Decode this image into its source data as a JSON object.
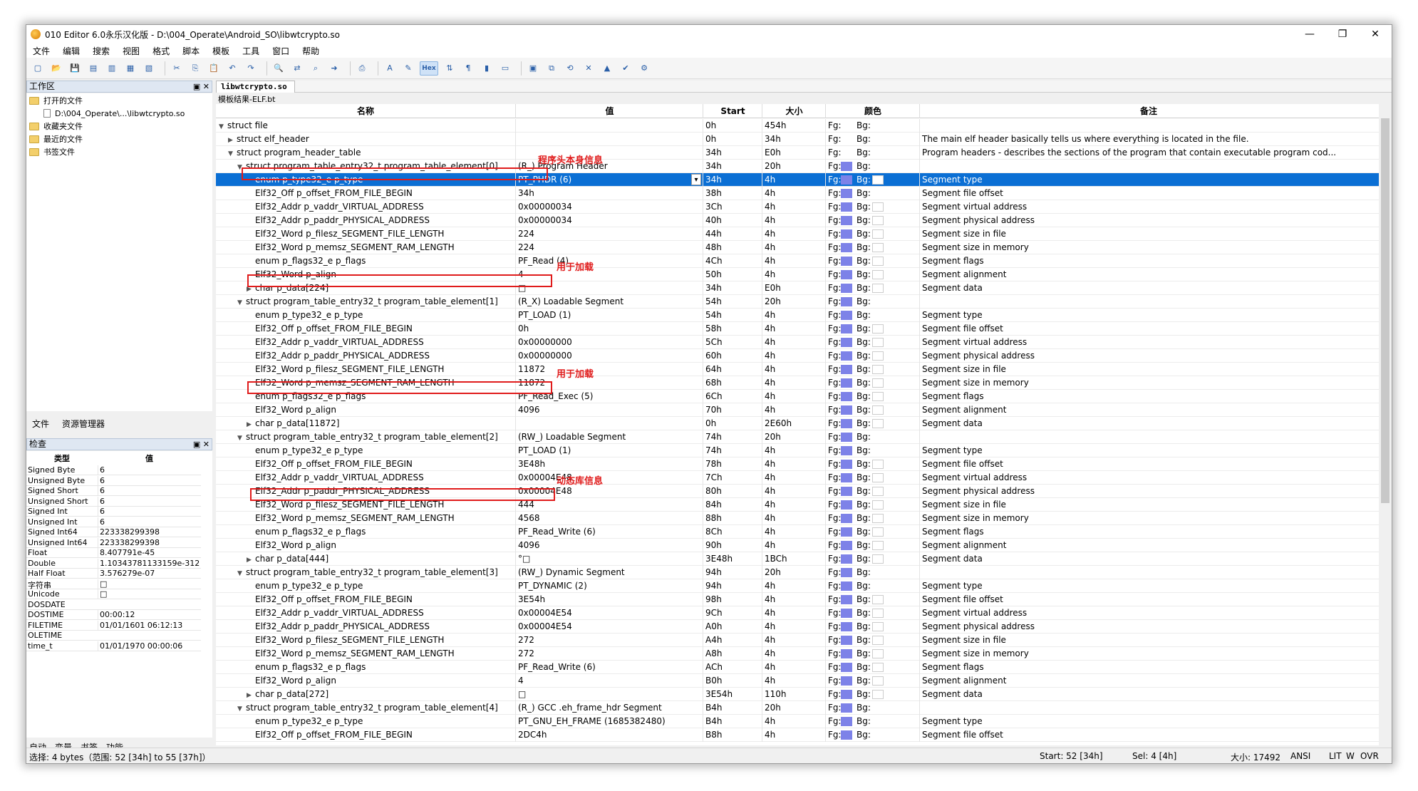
{
  "window": {
    "title": "010 Editor 6.0永乐汉化版 - D:\\004_Operate\\Android_SO\\libwtcrypto.so",
    "minimize": "—",
    "restore": "❐",
    "close": "✕"
  },
  "menu": [
    "文件",
    "编辑",
    "搜索",
    "视图",
    "格式",
    "脚本",
    "模板",
    "工具",
    "窗口",
    "帮助"
  ],
  "toolbar": {
    "hex_label": "Hex"
  },
  "workspace": {
    "title": "工作区",
    "items": [
      {
        "label": "打开的文件"
      },
      {
        "label": "D:\\004_Operate\\...\\libwtcrypto.so"
      },
      {
        "label": "收藏夹文件"
      },
      {
        "label": "最近的文件"
      },
      {
        "label": "书签文件"
      }
    ]
  },
  "left_tabs": [
    "文件",
    "资源管理器"
  ],
  "inspector": {
    "title": "检查",
    "headers": [
      "类型",
      "值"
    ],
    "rows": [
      {
        "k": "Signed Byte",
        "v": "6"
      },
      {
        "k": "Unsigned Byte",
        "v": "6"
      },
      {
        "k": "Signed Short",
        "v": "6"
      },
      {
        "k": "Unsigned Short",
        "v": "6"
      },
      {
        "k": "Signed Int",
        "v": "6"
      },
      {
        "k": "Unsigned Int",
        "v": "6"
      },
      {
        "k": "Signed Int64",
        "v": "223338299398"
      },
      {
        "k": "Unsigned Int64",
        "v": "223338299398"
      },
      {
        "k": "Float",
        "v": "8.407791e-45"
      },
      {
        "k": "Double",
        "v": "1.10343781133159e-312"
      },
      {
        "k": "Half Float",
        "v": "3.576279e-07"
      },
      {
        "k": "字符串",
        "v": "□"
      },
      {
        "k": "Unicode",
        "v": "□"
      },
      {
        "k": "DOSDATE",
        "v": ""
      },
      {
        "k": "DOSTIME",
        "v": "00:00:12"
      },
      {
        "k": "FILETIME",
        "v": "01/01/1601 06:12:13"
      },
      {
        "k": "OLETIME",
        "v": ""
      },
      {
        "k": "time_t",
        "v": "01/01/1970 00:00:06"
      }
    ]
  },
  "bottom_tabs": [
    "自动",
    "变量",
    "书签",
    "功能"
  ],
  "file_tab": "libwtcrypto.so",
  "template_result": "模板结果-ELF.bt",
  "grid": {
    "headers": [
      "名称",
      "值",
      "Start",
      "大小",
      "颜色",
      "备注"
    ],
    "fg_label": "Fg:",
    "bg_label": "Bg:",
    "rows": [
      {
        "d": 0,
        "a": "v",
        "n": "struct file",
        "v": "",
        "s": "0h",
        "z": "454h",
        "fs": false,
        "bs": false,
        "m": ""
      },
      {
        "d": 1,
        "a": ">",
        "n": "struct elf_header",
        "v": "",
        "s": "0h",
        "z": "34h",
        "fs": false,
        "bs": false,
        "m": "The main elf header basically tells us where everything is located in the file."
      },
      {
        "d": 1,
        "a": "v",
        "n": "struct program_header_table",
        "v": "",
        "s": "34h",
        "z": "E0h",
        "fs": false,
        "bs": false,
        "m": "Program headers - describes the sections of the program that contain executable program cod..."
      },
      {
        "d": 2,
        "a": "v",
        "n": "struct program_table_entry32_t program_table_element[0]",
        "v": "(R_) Program Header",
        "s": "34h",
        "z": "20h",
        "fs": true,
        "bs": false,
        "m": ""
      },
      {
        "d": 3,
        "a": "",
        "n": "enum p_type32_e p_type",
        "v": "PT_PHDR (6)",
        "s": "34h",
        "z": "4h",
        "fs": true,
        "bs": true,
        "m": "Segment type",
        "sel": true
      },
      {
        "d": 3,
        "a": "",
        "n": "Elf32_Off p_offset_FROM_FILE_BEGIN",
        "v": "34h",
        "s": "38h",
        "z": "4h",
        "fs": true,
        "bs": false,
        "m": "Segment file offset"
      },
      {
        "d": 3,
        "a": "",
        "n": "Elf32_Addr p_vaddr_VIRTUAL_ADDRESS",
        "v": "0x00000034",
        "s": "3Ch",
        "z": "4h",
        "fs": true,
        "bs": true,
        "m": "Segment virtual address"
      },
      {
        "d": 3,
        "a": "",
        "n": "Elf32_Addr p_paddr_PHYSICAL_ADDRESS",
        "v": "0x00000034",
        "s": "40h",
        "z": "4h",
        "fs": true,
        "bs": true,
        "m": "Segment physical address"
      },
      {
        "d": 3,
        "a": "",
        "n": "Elf32_Word p_filesz_SEGMENT_FILE_LENGTH",
        "v": "224",
        "s": "44h",
        "z": "4h",
        "fs": true,
        "bs": true,
        "m": "Segment size in file"
      },
      {
        "d": 3,
        "a": "",
        "n": "Elf32_Word p_memsz_SEGMENT_RAM_LENGTH",
        "v": "224",
        "s": "48h",
        "z": "4h",
        "fs": true,
        "bs": true,
        "m": "Segment size in memory"
      },
      {
        "d": 3,
        "a": "",
        "n": "enum p_flags32_e p_flags",
        "v": "PF_Read (4)",
        "s": "4Ch",
        "z": "4h",
        "fs": true,
        "bs": true,
        "m": "Segment flags"
      },
      {
        "d": 3,
        "a": "",
        "n": "Elf32_Word p_align",
        "v": "4",
        "s": "50h",
        "z": "4h",
        "fs": true,
        "bs": true,
        "m": "Segment alignment"
      },
      {
        "d": 3,
        "a": ">",
        "n": "char p_data[224]",
        "v": "□",
        "s": "34h",
        "z": "E0h",
        "fs": true,
        "bs": true,
        "m": "Segment data"
      },
      {
        "d": 2,
        "a": "v",
        "n": "struct program_table_entry32_t program_table_element[1]",
        "v": "(R_X) Loadable Segment",
        "s": "54h",
        "z": "20h",
        "fs": true,
        "bs": false,
        "m": ""
      },
      {
        "d": 3,
        "a": "",
        "n": "enum p_type32_e p_type",
        "v": "PT_LOAD (1)",
        "s": "54h",
        "z": "4h",
        "fs": true,
        "bs": false,
        "m": "Segment type"
      },
      {
        "d": 3,
        "a": "",
        "n": "Elf32_Off p_offset_FROM_FILE_BEGIN",
        "v": "0h",
        "s": "58h",
        "z": "4h",
        "fs": true,
        "bs": true,
        "m": "Segment file offset"
      },
      {
        "d": 3,
        "a": "",
        "n": "Elf32_Addr p_vaddr_VIRTUAL_ADDRESS",
        "v": "0x00000000",
        "s": "5Ch",
        "z": "4h",
        "fs": true,
        "bs": true,
        "m": "Segment virtual address"
      },
      {
        "d": 3,
        "a": "",
        "n": "Elf32_Addr p_paddr_PHYSICAL_ADDRESS",
        "v": "0x00000000",
        "s": "60h",
        "z": "4h",
        "fs": true,
        "bs": true,
        "m": "Segment physical address"
      },
      {
        "d": 3,
        "a": "",
        "n": "Elf32_Word p_filesz_SEGMENT_FILE_LENGTH",
        "v": "11872",
        "s": "64h",
        "z": "4h",
        "fs": true,
        "bs": true,
        "m": "Segment size in file"
      },
      {
        "d": 3,
        "a": "",
        "n": "Elf32_Word p_memsz_SEGMENT_RAM_LENGTH",
        "v": "11872",
        "s": "68h",
        "z": "4h",
        "fs": true,
        "bs": true,
        "m": "Segment size in memory"
      },
      {
        "d": 3,
        "a": "",
        "n": "enum p_flags32_e p_flags",
        "v": "PF_Read_Exec (5)",
        "s": "6Ch",
        "z": "4h",
        "fs": true,
        "bs": true,
        "m": "Segment flags"
      },
      {
        "d": 3,
        "a": "",
        "n": "Elf32_Word p_align",
        "v": "4096",
        "s": "70h",
        "z": "4h",
        "fs": true,
        "bs": true,
        "m": "Segment alignment"
      },
      {
        "d": 3,
        "a": ">",
        "n": "char p_data[11872]",
        "v": "",
        "s": "0h",
        "z": "2E60h",
        "fs": true,
        "bs": true,
        "m": "Segment data"
      },
      {
        "d": 2,
        "a": "v",
        "n": "struct program_table_entry32_t program_table_element[2]",
        "v": "(RW_) Loadable Segment",
        "s": "74h",
        "z": "20h",
        "fs": true,
        "bs": false,
        "m": ""
      },
      {
        "d": 3,
        "a": "",
        "n": "enum p_type32_e p_type",
        "v": "PT_LOAD (1)",
        "s": "74h",
        "z": "4h",
        "fs": true,
        "bs": false,
        "m": "Segment type"
      },
      {
        "d": 3,
        "a": "",
        "n": "Elf32_Off p_offset_FROM_FILE_BEGIN",
        "v": "3E48h",
        "s": "78h",
        "z": "4h",
        "fs": true,
        "bs": true,
        "m": "Segment file offset"
      },
      {
        "d": 3,
        "a": "",
        "n": "Elf32_Addr p_vaddr_VIRTUAL_ADDRESS",
        "v": "0x00004E48",
        "s": "7Ch",
        "z": "4h",
        "fs": true,
        "bs": true,
        "m": "Segment virtual address"
      },
      {
        "d": 3,
        "a": "",
        "n": "Elf32_Addr p_paddr_PHYSICAL_ADDRESS",
        "v": "0x00004E48",
        "s": "80h",
        "z": "4h",
        "fs": true,
        "bs": true,
        "m": "Segment physical address"
      },
      {
        "d": 3,
        "a": "",
        "n": "Elf32_Word p_filesz_SEGMENT_FILE_LENGTH",
        "v": "444",
        "s": "84h",
        "z": "4h",
        "fs": true,
        "bs": true,
        "m": "Segment size in file"
      },
      {
        "d": 3,
        "a": "",
        "n": "Elf32_Word p_memsz_SEGMENT_RAM_LENGTH",
        "v": "4568",
        "s": "88h",
        "z": "4h",
        "fs": true,
        "bs": true,
        "m": "Segment size in memory"
      },
      {
        "d": 3,
        "a": "",
        "n": "enum p_flags32_e p_flags",
        "v": "PF_Read_Write (6)",
        "s": "8Ch",
        "z": "4h",
        "fs": true,
        "bs": true,
        "m": "Segment flags"
      },
      {
        "d": 3,
        "a": "",
        "n": "Elf32_Word p_align",
        "v": "4096",
        "s": "90h",
        "z": "4h",
        "fs": true,
        "bs": true,
        "m": "Segment alignment"
      },
      {
        "d": 3,
        "a": ">",
        "n": "char p_data[444]",
        "v": "°□",
        "s": "3E48h",
        "z": "1BCh",
        "fs": true,
        "bs": true,
        "m": "Segment data"
      },
      {
        "d": 2,
        "a": "v",
        "n": "struct program_table_entry32_t program_table_element[3]",
        "v": "(RW_) Dynamic Segment",
        "s": "94h",
        "z": "20h",
        "fs": true,
        "bs": false,
        "m": ""
      },
      {
        "d": 3,
        "a": "",
        "n": "enum p_type32_e p_type",
        "v": "PT_DYNAMIC (2)",
        "s": "94h",
        "z": "4h",
        "fs": true,
        "bs": false,
        "m": "Segment type"
      },
      {
        "d": 3,
        "a": "",
        "n": "Elf32_Off p_offset_FROM_FILE_BEGIN",
        "v": "3E54h",
        "s": "98h",
        "z": "4h",
        "fs": true,
        "bs": true,
        "m": "Segment file offset"
      },
      {
        "d": 3,
        "a": "",
        "n": "Elf32_Addr p_vaddr_VIRTUAL_ADDRESS",
        "v": "0x00004E54",
        "s": "9Ch",
        "z": "4h",
        "fs": true,
        "bs": true,
        "m": "Segment virtual address"
      },
      {
        "d": 3,
        "a": "",
        "n": "Elf32_Addr p_paddr_PHYSICAL_ADDRESS",
        "v": "0x00004E54",
        "s": "A0h",
        "z": "4h",
        "fs": true,
        "bs": true,
        "m": "Segment physical address"
      },
      {
        "d": 3,
        "a": "",
        "n": "Elf32_Word p_filesz_SEGMENT_FILE_LENGTH",
        "v": "272",
        "s": "A4h",
        "z": "4h",
        "fs": true,
        "bs": true,
        "m": "Segment size in file"
      },
      {
        "d": 3,
        "a": "",
        "n": "Elf32_Word p_memsz_SEGMENT_RAM_LENGTH",
        "v": "272",
        "s": "A8h",
        "z": "4h",
        "fs": true,
        "bs": true,
        "m": "Segment size in memory"
      },
      {
        "d": 3,
        "a": "",
        "n": "enum p_flags32_e p_flags",
        "v": "PF_Read_Write (6)",
        "s": "ACh",
        "z": "4h",
        "fs": true,
        "bs": true,
        "m": "Segment flags"
      },
      {
        "d": 3,
        "a": "",
        "n": "Elf32_Word p_align",
        "v": "4",
        "s": "B0h",
        "z": "4h",
        "fs": true,
        "bs": true,
        "m": "Segment alignment"
      },
      {
        "d": 3,
        "a": ">",
        "n": "char p_data[272]",
        "v": "□",
        "s": "3E54h",
        "z": "110h",
        "fs": true,
        "bs": true,
        "m": "Segment data"
      },
      {
        "d": 2,
        "a": "v",
        "n": "struct program_table_entry32_t program_table_element[4]",
        "v": "(R_) GCC .eh_frame_hdr Segment",
        "s": "B4h",
        "z": "20h",
        "fs": true,
        "bs": false,
        "m": ""
      },
      {
        "d": 3,
        "a": "",
        "n": "enum p_type32_e p_type",
        "v": "PT_GNU_EH_FRAME (1685382480)",
        "s": "B4h",
        "z": "4h",
        "fs": true,
        "bs": false,
        "m": "Segment type"
      },
      {
        "d": 3,
        "a": "",
        "n": "Elf32_Off p_offset_FROM_FILE_BEGIN",
        "v": "2DC4h",
        "s": "B8h",
        "z": "4h",
        "fs": true,
        "bs": false,
        "m": "Segment file offset"
      }
    ]
  },
  "annotations": {
    "a0": "程序头本身信息",
    "a1": "用于加载",
    "a2": "用于加载",
    "a3": "动态库信息"
  },
  "status": {
    "selection": "选择: 4 bytes（范围: 52 [34h] to 55 [37h]）",
    "start": "Start: 52 [34h]",
    "sel": "Sel: 4 [4h]",
    "size": "大小: 17492",
    "encoding": "ANSI",
    "lit": "LIT",
    "w": "W",
    "ovr": "OVR"
  },
  "colors": {
    "selection": "#0b6fd4",
    "fg_swatch": "#7d82e8",
    "annotation": "#e01b1b"
  }
}
